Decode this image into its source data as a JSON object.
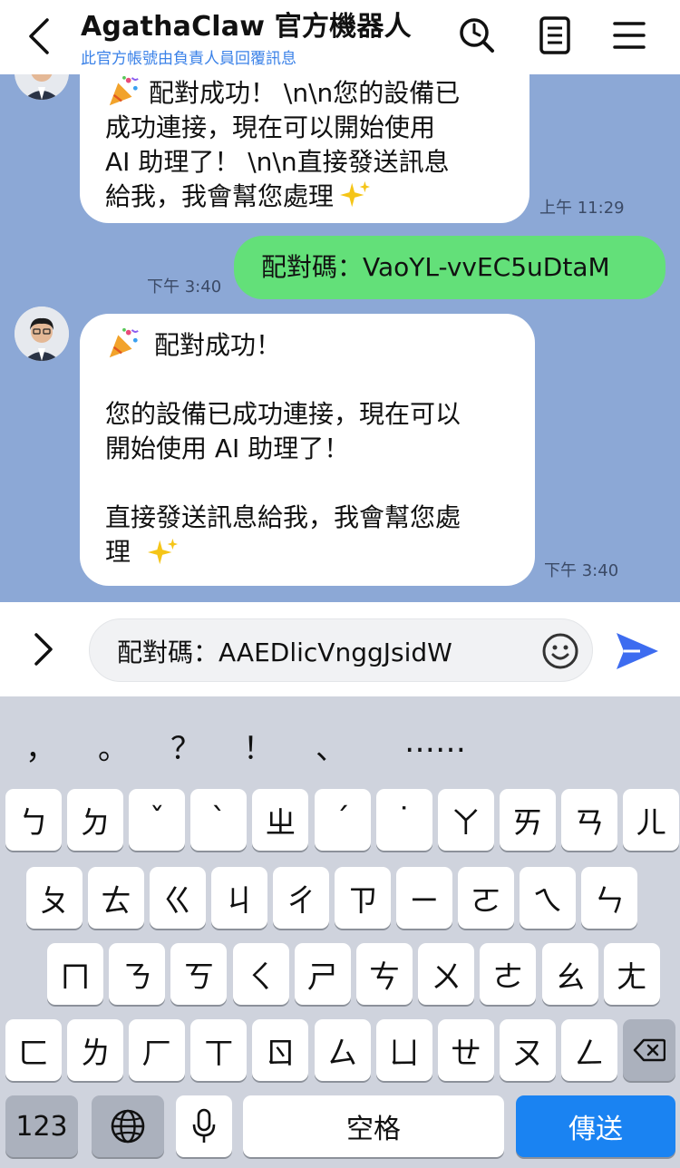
{
  "header": {
    "title": "AgathaClaw 官方機器人",
    "subtitle": "此官方帳號由負責人員回覆訊息"
  },
  "messages": [
    {
      "text": "配對成功！ \\n\\n您的設備已\n成功連接，現在可以開始使用\nAI 助理了！ \\n\\n直接發送訊息\n給我，我會幫您處理",
      "time": "上午 11:29"
    },
    {
      "text": "配對碼：VaoYL-vvEC5uDtaM",
      "time": "下午 3:40"
    },
    {
      "text": "配對成功！\n\n您的設備已成功連接，現在可以\n開始使用 AI 助理了！\n\n直接發送訊息給我，我會幫您處\n理",
      "time": "下午 3:40"
    }
  ],
  "composer": {
    "value": "配對碼：AAEDlicVnggJsidW"
  },
  "keyboard": {
    "punctuation": [
      "，",
      "。",
      "？",
      "！",
      "、",
      "……"
    ],
    "row1": [
      "ㄅ",
      "ㄉ",
      "ˇ",
      "ˋ",
      "ㄓ",
      "ˊ",
      "˙",
      "ㄚ",
      "ㄞ",
      "ㄢ",
      "ㄦ"
    ],
    "row2": [
      "ㄆ",
      "ㄊ",
      "ㄍ",
      "ㄐ",
      "ㄔ",
      "ㄗ",
      "ㄧ",
      "ㄛ",
      "ㄟ",
      "ㄣ"
    ],
    "row3": [
      "ㄇ",
      "ㄋ",
      "ㄎ",
      "ㄑ",
      "ㄕ",
      "ㄘ",
      "ㄨ",
      "ㄜ",
      "ㄠ",
      "ㄤ"
    ],
    "row4": [
      "ㄈ",
      "ㄌ",
      "ㄏ",
      "ㄒ",
      "ㄖ",
      "ㄙ",
      "ㄩ",
      "ㄝ",
      "ㄡ",
      "ㄥ"
    ],
    "numbers_label": "123",
    "space_label": "空格",
    "send_label": "傳送"
  },
  "colors": {
    "chat_background": "#8ca8d6",
    "my_bubble": "#63e079",
    "send_key": "#1a83f2",
    "link_blue": "#3b82e8"
  },
  "icons": [
    "back-chevron-icon",
    "search-icon",
    "notes-icon",
    "menu-icon",
    "avatar",
    "party-popper-icon",
    "sparkles-icon",
    "chevron-right-icon",
    "smiley-icon",
    "send-icon",
    "backspace-icon",
    "globe-icon",
    "microphone-icon"
  ]
}
